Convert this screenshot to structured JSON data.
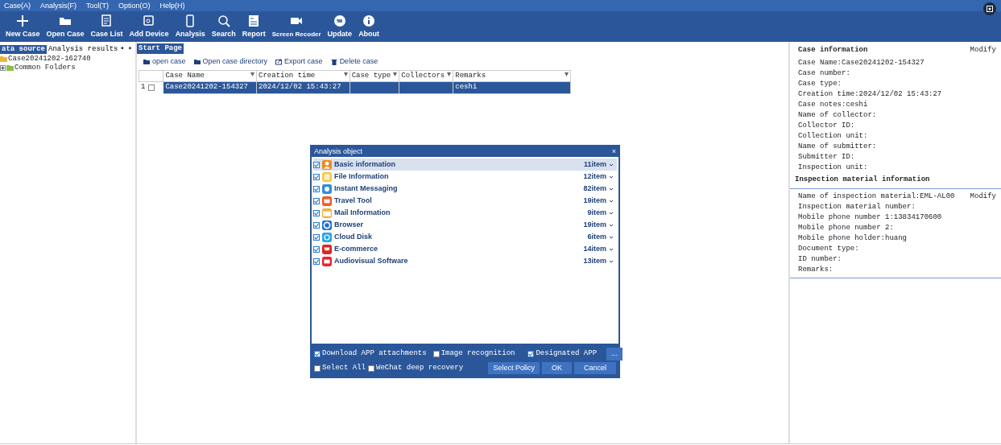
{
  "menu": [
    "Case(A)",
    "Analysis(F)",
    "Tool(T)",
    "Option(O)",
    "Help(H)"
  ],
  "toolbar": [
    "New Case",
    "Open Case",
    "Case List",
    "Add Device",
    "Analysis",
    "Search",
    "Report",
    "Screen Recoder",
    "Update",
    "About"
  ],
  "left_panel": {
    "tabs": [
      {
        "label": "ata source",
        "selected": true
      },
      {
        "label": "Analysis results",
        "selected": false
      }
    ],
    "scroll_arrows": "◂ ▸",
    "tree": [
      {
        "label": "Case20241202-162740",
        "children": [
          {
            "label": "Common Folders",
            "expanded": false
          }
        ]
      }
    ]
  },
  "main": {
    "tabs": [
      {
        "label": "Start Page",
        "selected": true
      }
    ],
    "actions": [
      "open case",
      "Open case directory",
      "Export case",
      "Delete case"
    ],
    "table": {
      "columns": [
        "Case Name",
        "Creation time",
        "Case type",
        "Collectors",
        "Remarks"
      ],
      "rows": [
        {
          "index": "1",
          "checked": false,
          "selected": true,
          "cells": [
            "Case20241202-154327",
            "2024/12/02 15:43:27",
            "",
            "",
            "ceshi"
          ]
        }
      ]
    }
  },
  "case_info": {
    "title": "Case information",
    "modify": "Modify",
    "fields": [
      "Case Name:Case20241202-154327",
      "Case number:",
      "Case type:",
      "Creation time:2024/12/02 15:43:27",
      "Case notes:ceshi",
      "Name of collector:",
      "Collector ID:",
      "Collection unit:",
      "Name of submitter:",
      "Submitter ID:",
      "Inspection unit:"
    ]
  },
  "material_info": {
    "title": "Inspection material information",
    "modify": "Modify",
    "fields": [
      "Name of inspection material:EML-AL00",
      "Inspection material number:",
      "Mobile phone number 1:13834170600",
      "Mobile phone number 2:",
      "Mobile phone holder:huang",
      "Document type:",
      "ID number:",
      "Remarks:"
    ]
  },
  "dialog": {
    "title": "Analysis object",
    "close": "×",
    "items": [
      {
        "label": "Basic information",
        "count": "11item",
        "checked": true,
        "selected": true,
        "color": "#f08a1c"
      },
      {
        "label": "File Information",
        "count": "12item",
        "checked": true,
        "selected": false,
        "color": "#f5c842"
      },
      {
        "label": "Instant Messaging",
        "count": "82item",
        "checked": true,
        "selected": false,
        "color": "#2f8fd8"
      },
      {
        "label": "Travel Tool",
        "count": "19item",
        "checked": true,
        "selected": false,
        "color": "#f05a28"
      },
      {
        "label": "Mail Information",
        "count": "9item",
        "checked": true,
        "selected": false,
        "color": "#f2b33d"
      },
      {
        "label": "Browser",
        "count": "19item",
        "checked": true,
        "selected": false,
        "color": "#1e6fd0"
      },
      {
        "label": "Cloud Disk",
        "count": "6item",
        "checked": true,
        "selected": false,
        "color": "#2aa6e8"
      },
      {
        "label": "E-commerce",
        "count": "14item",
        "checked": true,
        "selected": false,
        "color": "#e02424"
      },
      {
        "label": "Audiovisual Software",
        "count": "13item",
        "checked": true,
        "selected": false,
        "color": "#e8262e"
      }
    ],
    "options": [
      {
        "label": "Download APP attachments",
        "checked": true
      },
      {
        "label": "Image recognition",
        "checked": false
      },
      {
        "label": "Designated APP",
        "checked": true
      },
      {
        "label": "Select All",
        "checked": false
      },
      {
        "label": "WeChat deep recovery",
        "checked": false
      }
    ],
    "more": "...",
    "buttons": [
      "Select Policy",
      "OK",
      "Cancel"
    ]
  }
}
